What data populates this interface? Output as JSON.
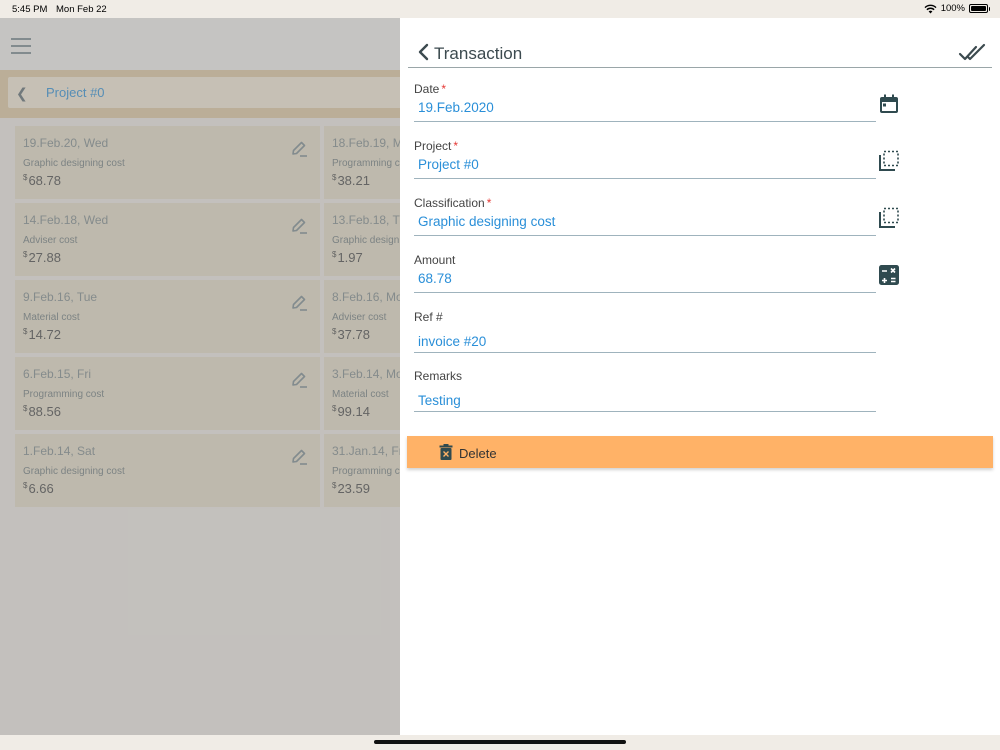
{
  "status": {
    "time": "5:45 PM",
    "date": "Mon Feb 22",
    "battery": "100%",
    "battery_level": 1.0
  },
  "background": {
    "breadcrumb": "Project #0",
    "cards": [
      {
        "date": "19.Feb.20, Wed",
        "category": "Graphic designing cost",
        "currency": "$",
        "amount": "68.78"
      },
      {
        "date": "18.Feb.19, Mo",
        "category": "Programming c",
        "currency": "$",
        "amount": "38.21"
      },
      {
        "date": "14.Feb.18, Wed",
        "category": "Adviser cost",
        "currency": "$",
        "amount": "27.88"
      },
      {
        "date": "13.Feb.18, Tu",
        "category": "Graphic design",
        "currency": "$",
        "amount": "1.97"
      },
      {
        "date": "9.Feb.16, Tue",
        "category": "Material cost",
        "currency": "$",
        "amount": "14.72"
      },
      {
        "date": "8.Feb.16, Mo",
        "category": "Adviser cost",
        "currency": "$",
        "amount": "37.78"
      },
      {
        "date": "6.Feb.15, Fri",
        "category": "Programming cost",
        "currency": "$",
        "amount": "88.56"
      },
      {
        "date": "3.Feb.14, Mo",
        "category": "Material cost",
        "currency": "$",
        "amount": "99.14"
      },
      {
        "date": "1.Feb.14, Sat",
        "category": "Graphic designing cost",
        "currency": "$",
        "amount": "6.66"
      },
      {
        "date": "31.Jan.14, Fri",
        "category": "Programming c",
        "currency": "$",
        "amount": "23.59"
      }
    ]
  },
  "drawer": {
    "title": "Transaction",
    "fields": {
      "date": {
        "label": "Date",
        "required": "*",
        "value": "19.Feb.2020",
        "icon": "calendar-icon"
      },
      "project": {
        "label": "Project",
        "required": "*",
        "value": "Project #0",
        "icon": "select-icon"
      },
      "classification": {
        "label": "Classification",
        "required": "*",
        "value": "Graphic designing cost",
        "icon": "select-icon"
      },
      "amount": {
        "label": "Amount",
        "value": "68.78",
        "icon": "calculator-icon"
      },
      "ref": {
        "label": "Ref #",
        "value": "invoice #20"
      },
      "remarks": {
        "label": "Remarks",
        "value": "Testing"
      }
    },
    "delete_label": "Delete"
  },
  "colors": {
    "accent": "#2a8fd8",
    "delete_bg": "#ffb267",
    "required": "#e53935",
    "icon_dark": "#2f4a4f"
  }
}
